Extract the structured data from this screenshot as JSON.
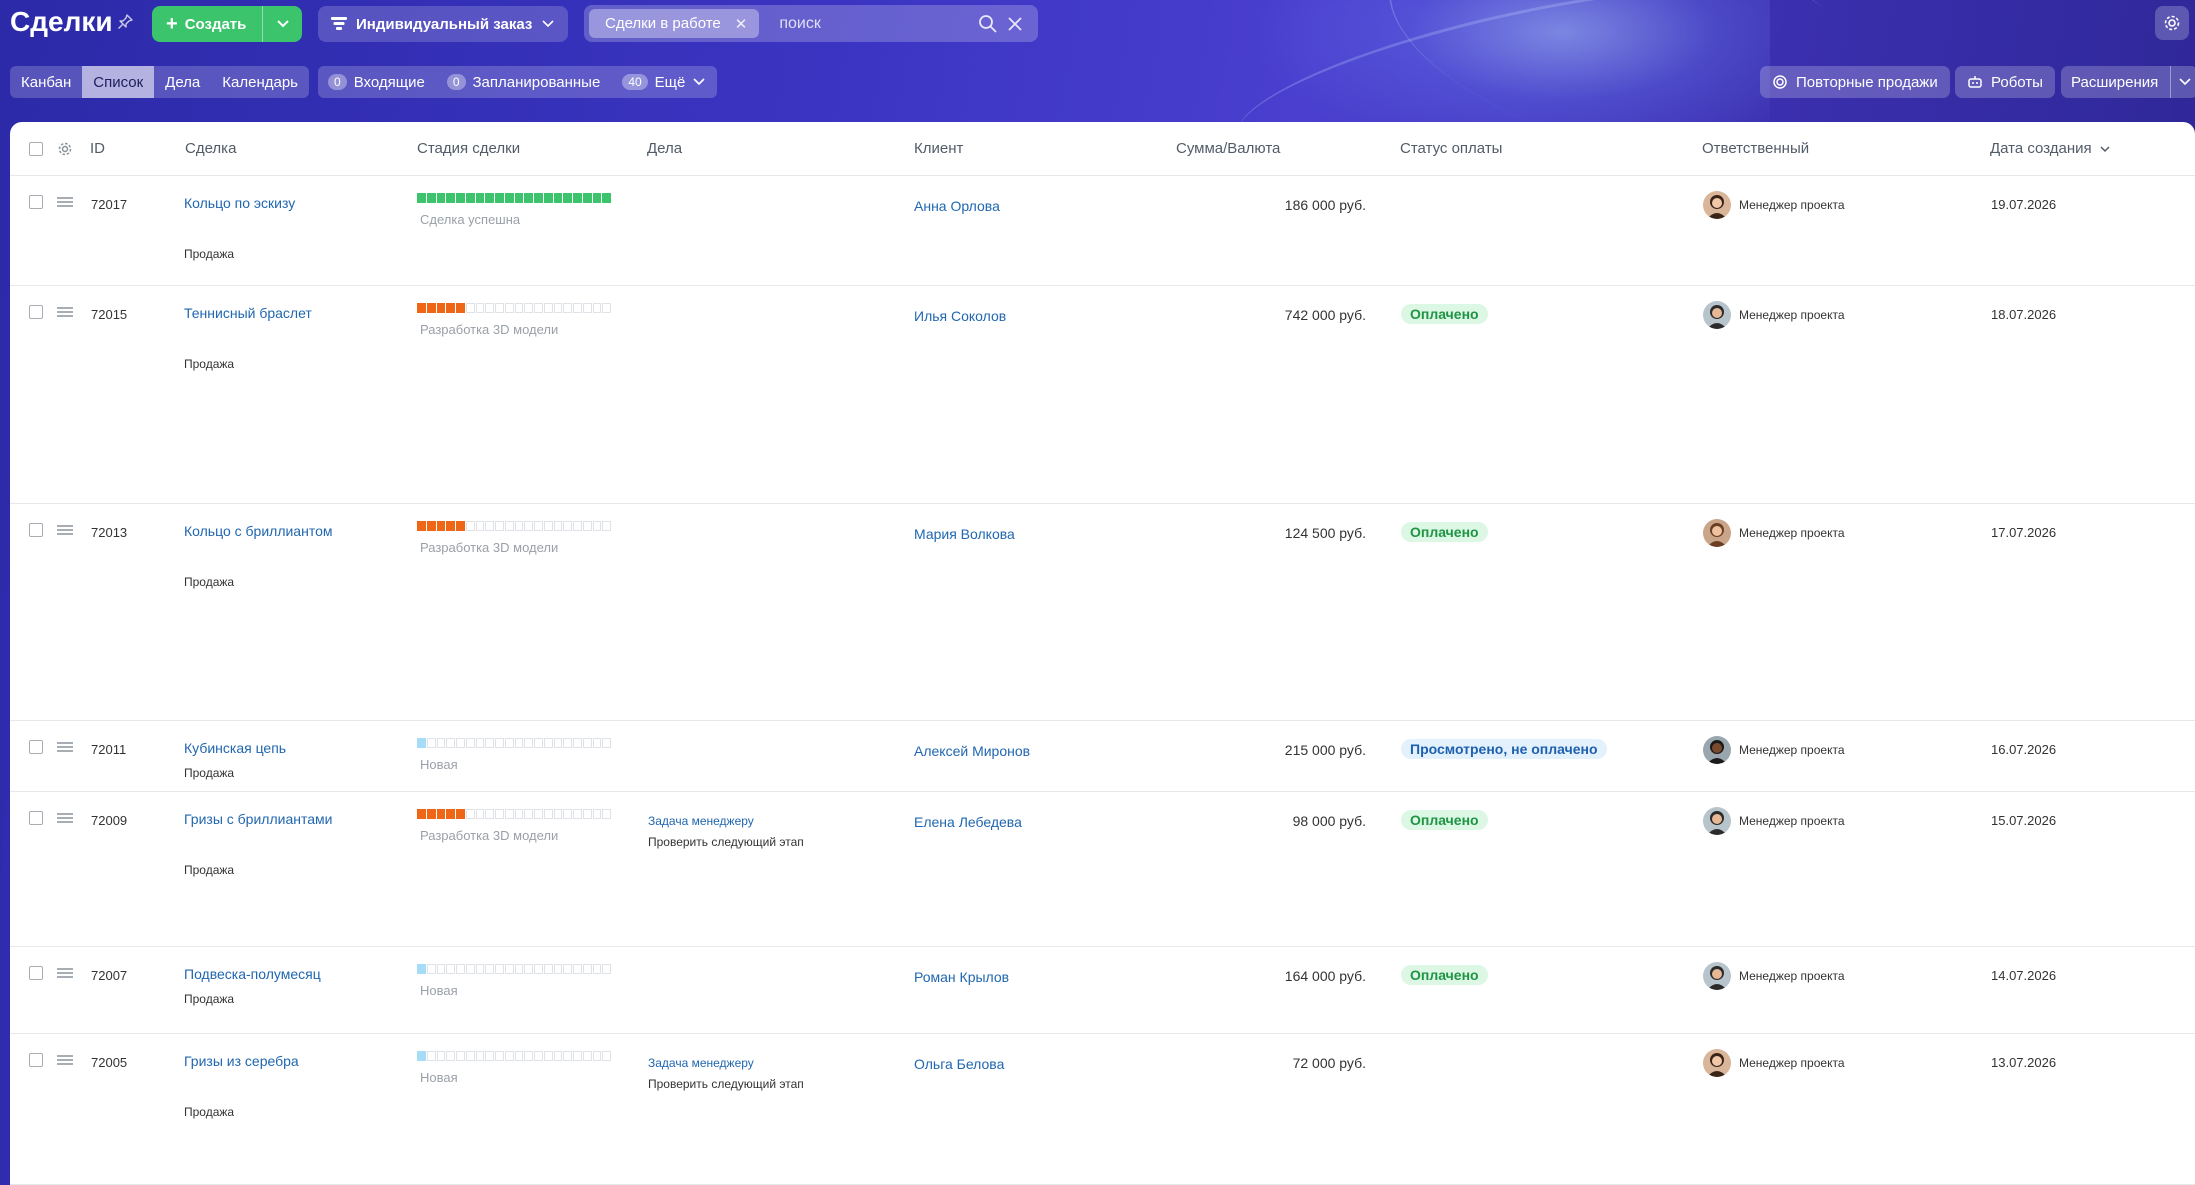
{
  "header": {
    "title": "Сделки",
    "create_label": "Создать",
    "funnel_label": "Индивидуальный заказ",
    "filter_chip": "Сделки в работе",
    "search_placeholder": "поиск"
  },
  "view_tabs": [
    {
      "label": "Канбан",
      "active": false
    },
    {
      "label": "Список",
      "active": true
    },
    {
      "label": "Дела",
      "active": false
    },
    {
      "label": "Календарь",
      "active": false
    }
  ],
  "counters": [
    {
      "count": "0",
      "label": "Входящие"
    },
    {
      "count": "0",
      "label": "Запланированные"
    },
    {
      "count": "40",
      "label": "Ещё"
    }
  ],
  "right_buttons": {
    "repeat_sales": "Повторные продажи",
    "robots": "Роботы",
    "extensions": "Расширения"
  },
  "columns": [
    "ID",
    "Сделка",
    "Стадия сделки",
    "Дела",
    "Клиент",
    "Сумма/Валюта",
    "Статус оплаты",
    "Ответственный",
    "Дата создания"
  ],
  "colors": {
    "stage_success": "#3bc46b",
    "stage_3d": "#f06617",
    "stage_new": "#a6dcf7",
    "link": "#2067b0"
  },
  "rows": [
    {
      "id": "72017",
      "deal": "Кольцо по эскизу",
      "type": "Продажа",
      "stage": "Сделка успешна",
      "stage_kind": "success",
      "stage_fill": 1.0,
      "task_link": "",
      "task_text": "",
      "client": "Анна Орлова",
      "sum": "186 000 руб.",
      "payment": "",
      "payment_kind": "",
      "responsible": "Менеджер проекта",
      "avatar": "female",
      "date": "19.07.2026"
    },
    {
      "id": "72015",
      "deal": "Теннисный браслет",
      "type": "Продажа",
      "stage": "Разработка 3D модели",
      "stage_kind": "3d",
      "stage_fill": 0.27,
      "task_link": "",
      "task_text": "",
      "client": "Илья Соколов",
      "sum": "742 000 руб.",
      "payment": "Оплачено",
      "payment_kind": "paid",
      "responsible": "Менеджер проекта",
      "avatar": "male",
      "date": "18.07.2026"
    },
    {
      "id": "72013",
      "deal": "Кольцо с бриллиантом",
      "type": "Продажа",
      "stage": "Разработка 3D модели",
      "stage_kind": "3d",
      "stage_fill": 0.27,
      "task_link": "",
      "task_text": "",
      "client": "Мария Волкова",
      "sum": "124 500 руб.",
      "payment": "Оплачено",
      "payment_kind": "paid",
      "responsible": "Менеджер проекта",
      "avatar": "female2",
      "date": "17.07.2026"
    },
    {
      "id": "72011",
      "deal": "Кубинская цепь",
      "type": "Продажа",
      "stage": "Новая",
      "stage_kind": "new",
      "stage_fill": 0.05,
      "task_link": "",
      "task_text": "",
      "client": "Алексей Миронов",
      "sum": "215 000 руб.",
      "payment": "Просмотрено, не оплачено",
      "payment_kind": "viewed",
      "responsible": "Менеджер проекта",
      "avatar": "male2",
      "date": "16.07.2026"
    },
    {
      "id": "72009",
      "deal": "Гризы с бриллиантами",
      "type": "Продажа",
      "stage": "Разработка 3D модели",
      "stage_kind": "3d",
      "stage_fill": 0.27,
      "task_link": "Задача менеджеру",
      "task_text": "Проверить следующий этап",
      "client": "Елена Лебедева",
      "sum": "98 000 руб.",
      "payment": "Оплачено",
      "payment_kind": "paid",
      "responsible": "Менеджер проекта",
      "avatar": "male",
      "date": "15.07.2026"
    },
    {
      "id": "72007",
      "deal": "Подвеска-полумесяц",
      "type": "Продажа",
      "stage": "Новая",
      "stage_kind": "new",
      "stage_fill": 0.05,
      "task_link": "",
      "task_text": "",
      "client": "Роман Крылов",
      "sum": "164 000 руб.",
      "payment": "Оплачено",
      "payment_kind": "paid",
      "responsible": "Менеджер проекта",
      "avatar": "male",
      "date": "14.07.2026"
    },
    {
      "id": "72005",
      "deal": "Гризы из серебра",
      "type": "Продажа",
      "stage": "Новая",
      "stage_kind": "new",
      "stage_fill": 0.05,
      "task_link": "Задача менеджеру",
      "task_text": "Проверить следующий этап",
      "client": "Ольга Белова",
      "sum": "72 000 руб.",
      "payment": "",
      "payment_kind": "",
      "responsible": "Менеджер проекта",
      "avatar": "female",
      "date": "13.07.2026"
    }
  ]
}
